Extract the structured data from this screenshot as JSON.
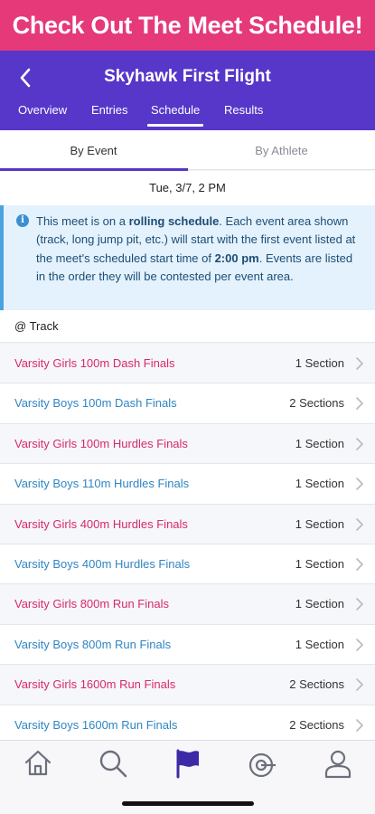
{
  "promo": {
    "text": "Check Out The Meet Schedule!"
  },
  "header": {
    "title": "Skyhawk First Flight",
    "back_icon": "chevron-left-icon",
    "tabs": [
      "Overview",
      "Entries",
      "Schedule",
      "Results"
    ],
    "active_tab": "Schedule"
  },
  "segment": {
    "left": "By Event",
    "right": "By Athlete",
    "active": "By Event"
  },
  "date": "Tue, 3/7, 2 PM",
  "info": {
    "icon": "info-icon",
    "pre": "This meet is on a ",
    "bold1": "rolling schedule",
    "mid": ". Each event area shown (track, long jump pit, etc.) will start with the first event listed at the meet's scheduled start time of ",
    "bold2": "2:00 pm",
    "post": ". Events are listed in the order they will be contested per event area."
  },
  "group_header": "@ Track",
  "events": [
    {
      "name": "Varsity Girls 100m Dash Finals",
      "sections": "1 Section"
    },
    {
      "name": "Varsity Boys 100m Dash Finals",
      "sections": "2 Sections"
    },
    {
      "name": "Varsity Girls 100m Hurdles Finals",
      "sections": "1 Section"
    },
    {
      "name": "Varsity Boys 110m Hurdles Finals",
      "sections": "1 Section"
    },
    {
      "name": "Varsity Girls 400m Hurdles Finals",
      "sections": "1 Section"
    },
    {
      "name": "Varsity Boys 400m Hurdles Finals",
      "sections": "1 Section"
    },
    {
      "name": "Varsity Girls 800m Run Finals",
      "sections": "1 Section"
    },
    {
      "name": "Varsity Boys 800m Run Finals",
      "sections": "1 Section"
    },
    {
      "name": "Varsity Girls 1600m Run Finals",
      "sections": "2 Sections"
    },
    {
      "name": "Varsity Boys 1600m Run Finals",
      "sections": "2 Sections"
    }
  ],
  "bottom_nav": [
    "home-icon",
    "search-icon",
    "flag-icon",
    "target-icon",
    "profile-icon"
  ],
  "colors": {
    "promo": "#e5397a",
    "header": "#5637c9",
    "girls": "#d82a66",
    "boys": "#2f86c2",
    "active_nav": "#3d2aa6"
  }
}
